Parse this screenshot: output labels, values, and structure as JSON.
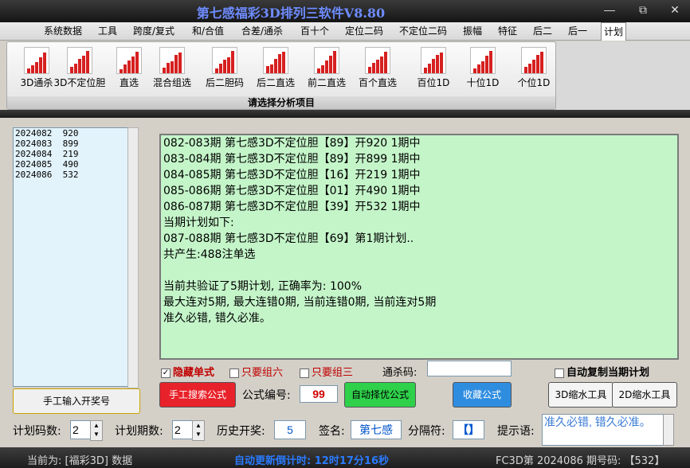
{
  "title": "第七感福彩3D排列三软件V8.80",
  "menu": [
    "系统数据",
    "工具",
    "跨度/复式",
    "和/合值",
    "合差/通杀",
    "百十个",
    "定位二码",
    "不定位二码",
    "振幅",
    "特征",
    "后二",
    "后一",
    "计划"
  ],
  "ribbon": {
    "tools": [
      "3D通杀",
      "3D不定位胆",
      "直选",
      "混合组选",
      "后二胆码",
      "后二直选",
      "前二直选",
      "百个直选",
      "百位1D",
      "十位1D",
      "个位1D"
    ],
    "footer": "请选择分析项目"
  },
  "history": [
    {
      "period": "2024082",
      "num": "920"
    },
    {
      "period": "2024083",
      "num": "899"
    },
    {
      "period": "2024084",
      "num": "219"
    },
    {
      "period": "2024085",
      "num": "490"
    },
    {
      "period": "2024086",
      "num": "532"
    }
  ],
  "manual_input_label": "手工输入开奖号",
  "plan_lines": [
    "082-083期 第七感3D不定位胆【89】开920 1期中",
    "083-084期 第七感3D不定位胆【89】开899 1期中",
    "084-085期 第七感3D不定位胆【16】开219 1期中",
    "085-086期 第七感3D不定位胆【01】开490 1期中",
    "086-087期 第七感3D不定位胆【39】开532 1期中",
    "当期计划如下:",
    "087-088期 第七感3D不定位胆【69】第1期计划..",
    "共产生:488注单选",
    "",
    "当前共验证了5期计划, 正确率为: 100%",
    "最大连对5期, 最大连错0期, 当前连错0期, 当前连对5期",
    "准久必错, 错久必准。"
  ],
  "options": {
    "hide_single": {
      "label": "隐藏单式",
      "checked": true
    },
    "only_group6": {
      "label": "只要组六",
      "checked": false
    },
    "only_group3": {
      "label": "只要组三",
      "checked": false
    },
    "kill_code_label": "通杀码:",
    "kill_code_value": "",
    "auto_copy": {
      "label": "自动复制当期计划",
      "checked": false
    }
  },
  "buttons": {
    "manual_search": "手工搜索公式",
    "formula_no_label": "公式编号:",
    "formula_no": "99",
    "auto_select": "自动择优公式",
    "favorite": "收藏公式",
    "shrink3d": "3D缩水工具",
    "shrink2d": "2D缩水工具"
  },
  "params": {
    "plan_codes_label": "计划码数:",
    "plan_codes": "2",
    "plan_periods_label": "计划期数:",
    "plan_periods": "2",
    "history_label": "历史开奖:",
    "history_value": "5",
    "signature_label": "签名:",
    "signature_value": "第七感",
    "separator_label": "分隔符:",
    "separator_value": "【】",
    "hint_label": "提示语:",
    "hint_value": "准久必错, 错久必准。"
  },
  "status": {
    "current": "当前为: [福彩3D] 数据",
    "countdown": "自动更新倒计时:  12时17分16秒",
    "period": "FC3D第 2024086 期号码: 【532】"
  },
  "colors": {
    "accent": "#6e8cff",
    "red_button": "#e8222a",
    "green_button": "#2fd14b",
    "blue_button": "#2f8de0",
    "text_area_bg": "#c4f5c9"
  }
}
